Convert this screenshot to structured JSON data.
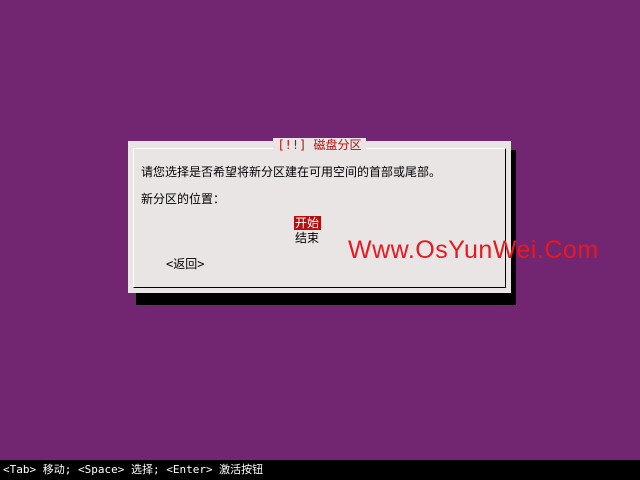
{
  "colors": {
    "background": "#722672",
    "dialog": "#e9e5e5",
    "accent": "#b50f0f",
    "watermark": "#e8181e",
    "status_bar": "#000000"
  },
  "dialog": {
    "title": "[!!] 磁盘分区",
    "prompt": "请您选择是否希望将新分区建在可用空间的首部或尾部。",
    "field_label": "新分区的位置：",
    "options": [
      {
        "label": "开始",
        "selected": true
      },
      {
        "label": "结束",
        "selected": false
      }
    ],
    "back_label": "<返回>"
  },
  "watermark": "Www.OsYunWei.Com",
  "status_bar": {
    "text": "<Tab> 移动; <Space> 选择; <Enter> 激活按钮"
  }
}
